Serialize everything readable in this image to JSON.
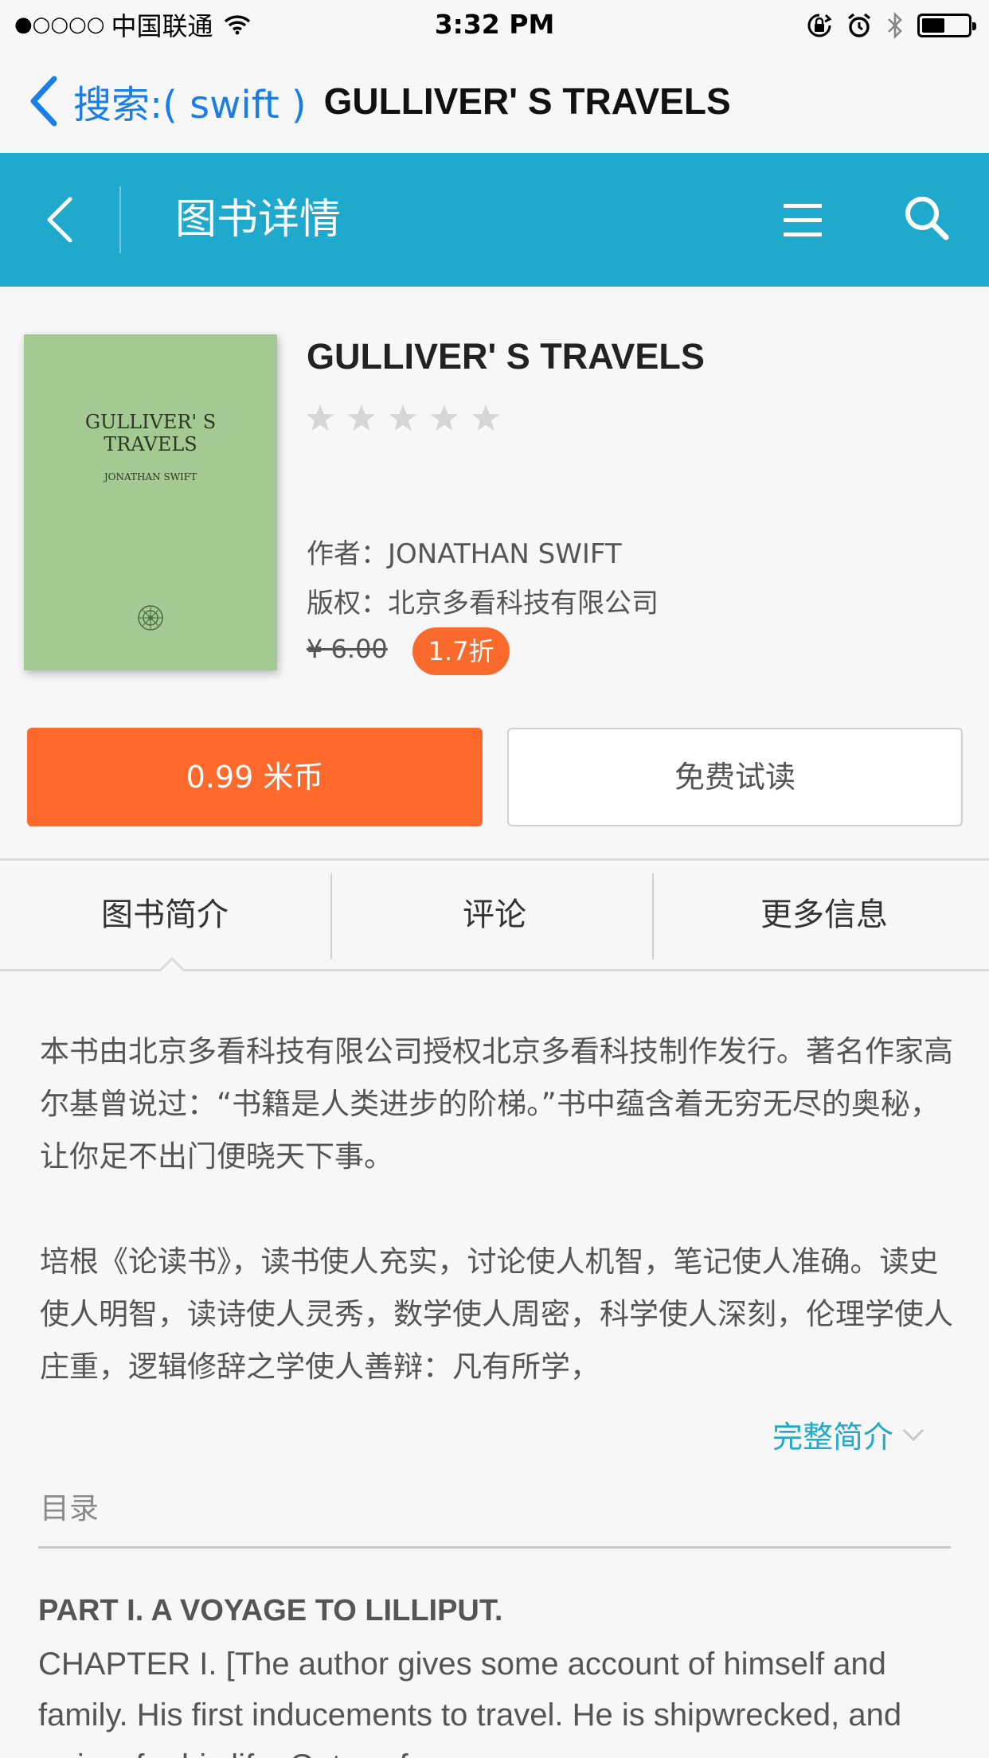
{
  "status_bar": {
    "signal": "●○○○○",
    "carrier": "中国联通",
    "time": "3:32 PM",
    "battery_level": 0.5
  },
  "nav": {
    "back_label": "搜索:( swift )",
    "title": "GULLIVER' S TRAVELS"
  },
  "header": {
    "title": "图书详情"
  },
  "book": {
    "cover_title": "GULLIVER' S\nTRAVELS",
    "cover_author": "JONATHAN SWIFT",
    "title": "GULLIVER' S TRAVELS",
    "rating": 0,
    "author_line": "作者：JONATHAN SWIFT",
    "rights_line": "版权：北京多看科技有限公司",
    "original_price": "¥ 6.00",
    "discount": "1.7折"
  },
  "actions": {
    "buy_label": "0.99 米币",
    "trial_label": "免费试读"
  },
  "tabs": [
    {
      "label": "图书简介"
    },
    {
      "label": "评论"
    },
    {
      "label": "更多信息"
    }
  ],
  "intro": {
    "paragraphs": [
      "本书由北京多看科技有限公司授权北京多看科技制作发行。著名作家高尔基曾说过：“书籍是人类进步的阶梯。”书中蕴含着无穷无尽的奥秘，让你足不出门便晓天下事。",
      "培根《论读书》，读书使人充实，讨论使人机智，笔记使人准确。读史使人明智，读诗使人灵秀，数学使人周密，科学使人深刻，伦理学使人庄重，逻辑修辞之学使人善辩：凡有所学，"
    ],
    "full_label": "完整简介"
  },
  "toc": {
    "label": "目录",
    "part": "PART I. A VOYAGE TO LILLIPUT.",
    "chapter": "CHAPTER I. [The author gives some account of himself and family. His first inducements to travel. He is shipwrecked, and swims for his life. Gets safe"
  },
  "colors": {
    "header_bg": "#1fa9cc",
    "buy_button": "#ff6a2c",
    "discount_badge": "#fa6a2d",
    "link_blue": "#1a7ee6",
    "cover_green": "#a5c992"
  }
}
